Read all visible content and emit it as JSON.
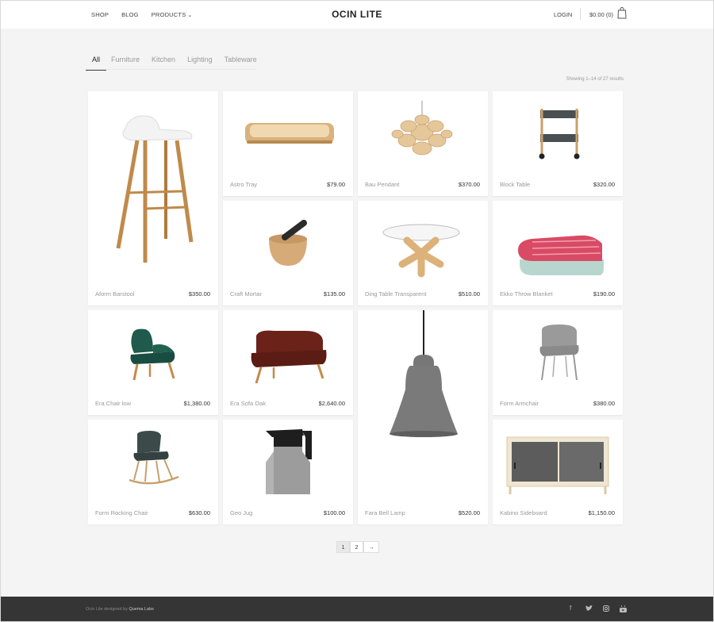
{
  "header": {
    "nav": [
      "SHOP",
      "BLOG",
      "PRODUCTS"
    ],
    "logo": "OCIN LITE",
    "login": "LOGIN",
    "cart": "$0.00 (0)"
  },
  "filters": [
    "All",
    "Furniture",
    "Kitchen",
    "Lighting",
    "Tableware"
  ],
  "results_text": "Showing 1–14 of 27 results",
  "products": [
    {
      "name": "Aform Barstool",
      "price": "$350.00"
    },
    {
      "name": "Astro Tray",
      "price": "$79.00"
    },
    {
      "name": "Bau Pendant",
      "price": "$370.00"
    },
    {
      "name": "Block Table",
      "price": "$320.00"
    },
    {
      "name": "Craft Mortar",
      "price": "$135.00"
    },
    {
      "name": "Ding Table Transparent",
      "price": "$510.00"
    },
    {
      "name": "Ekko Throw Blanket",
      "price": "$190.00"
    },
    {
      "name": "Era Chair low",
      "price": "$1,380.00"
    },
    {
      "name": "Era Sofa Oak",
      "price": "$2,640.00"
    },
    {
      "name": "Fara Bell Lamp",
      "price": "$520.00"
    },
    {
      "name": "Form Armchair",
      "price": "$380.00"
    },
    {
      "name": "Form Rocking Chair",
      "price": "$630.00"
    },
    {
      "name": "Geo Jug",
      "price": "$100.00"
    },
    {
      "name": "Kabino Sideboard",
      "price": "$1,150.00"
    }
  ],
  "pagination": [
    "1",
    "2",
    "→"
  ],
  "footer": {
    "prefix": "Ocin Lite designed by",
    "brand": "Quema Labs"
  },
  "social_icons": [
    "facebook-icon",
    "twitter-icon",
    "instagram-icon",
    "youtube-icon"
  ]
}
